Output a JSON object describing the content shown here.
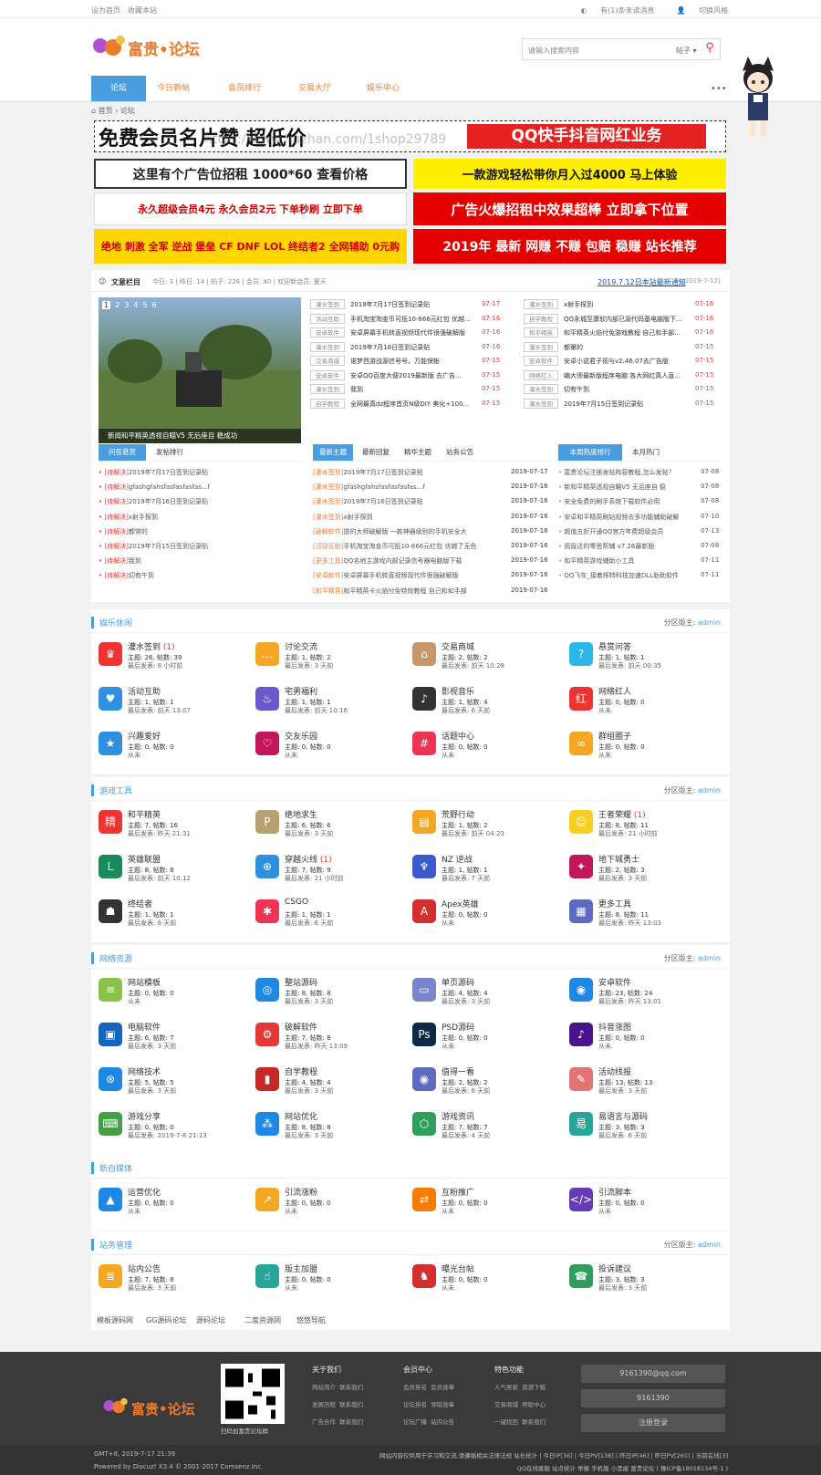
{
  "topbar": {
    "set_home": "设为首页",
    "bookmark": "收藏本站",
    "switch_style": "有(1)条未读消息",
    "login": "切换风格"
  },
  "header": {
    "logo": "富贵•论坛",
    "search_placeholder": "请输入搜索内容",
    "search_type": "帖子 ▾"
  },
  "nav": [
    "论坛",
    "今日新帖",
    "会员排行",
    "交易大厅",
    "娱乐中心"
  ],
  "breadcrumb": "首页 › 论坛",
  "ads": {
    "a1": "免费会员名片赞  超低价",
    "a1b": "QQ快手抖音网红业务",
    "a1w": "https://www.huzhan.com/1shop29789",
    "a2": "这里有个广告位招租 1000*60 查看价格",
    "a3": "一款游戏轻松带你月入过4000  马上体验",
    "a4": "永久超级会员4元 永久会员2元 下单秒刷 立即下单",
    "a5": "广告火爆招租中效果超棒 立即拿下位置",
    "a6": "绝地 刺激 全军 逆战 堡垒 CF DNF LOL 终结者2 全网辅助 0元购",
    "a7": "2019年 最新 网赚 不赚 包赔 稳赚 站长推荐"
  },
  "stats": {
    "label": "文意栏目",
    "text": "今日: 3 | 昨日: 14 | 帖子: 228 | 会员: 40 | 欢迎新会员: 夏天",
    "notice": "2019.7.12日本站最新通知",
    "notice_date": "(2019-7-12)"
  },
  "slide": {
    "pages": [
      "1",
      "2",
      "3",
      "4",
      "5",
      "6"
    ],
    "caption": "新闻和平精英透视自瞄V5 无后座自 稳成功"
  },
  "hot_left": [
    {
      "tag": "灌水签到",
      "title": "2019年7月17日签到记录贴",
      "date": "07-17"
    },
    {
      "tag": "活动互助",
      "title": "手机淘宝淘金币可抵10-666元红包 优越...",
      "date": "07-16"
    },
    {
      "tag": "安卓软件",
      "title": "安卓屏幕手机转直视频现代件很强破解版",
      "date": "07-16"
    },
    {
      "tag": "灌水签到",
      "title": "2019年7月16日签到记录贴",
      "date": "07-16"
    },
    {
      "tag": "交易商城",
      "title": "诺梦西游战源信号号，万能保帐",
      "date": "07-15"
    },
    {
      "tag": "安卓软件",
      "title": "安卓QQ百度大便2019最新版 去广告...",
      "date": "07-15"
    },
    {
      "tag": "灌水签到",
      "title": "我到",
      "date": "07-15"
    },
    {
      "tag": "自学教程",
      "title": "全网最真dz程序首页N级DIY 美化+100...",
      "date": "07-15"
    }
  ],
  "hot_right": [
    {
      "tag": "灌水签到",
      "title": "x射手探到",
      "date": "07-16"
    },
    {
      "tag": "自学教程",
      "title": "QQ永城至康软内部已源代码基电脑版下...",
      "date": "07-16"
    },
    {
      "tag": "和平精英",
      "title": "和平精英火焰付免游戏教程 自己和手部...",
      "date": "07-16"
    },
    {
      "tag": "灌水签到",
      "title": "都第的",
      "date": "07-15"
    },
    {
      "tag": "安卓软件",
      "title": "安卓小说君子视与v2.46.07去广告版",
      "date": "07-15"
    },
    {
      "tag": "网络红人",
      "title": "编大师最新版程序电脑 各大网红真人直...",
      "date": "07-15"
    },
    {
      "tag": "灌水签到",
      "title": "切有午到",
      "date": "07-15"
    },
    {
      "tag": "灌水签到",
      "title": "2019年7月15日签到记录贴",
      "date": "07-15"
    }
  ],
  "ask": {
    "tabs": [
      "问答悬赏",
      "发帖排行"
    ],
    "items": [
      {
        "s": "[待解决]",
        "t": "2019年7月17日签到记录贴"
      },
      {
        "s": "[待解决]",
        "t": "gfashgfahsfasfasfasfas...f"
      },
      {
        "s": "[待解决]",
        "t": "2019年7月16日签到记录贴"
      },
      {
        "s": "[待解决]",
        "t": "x射手探到"
      },
      {
        "s": "[待解决]",
        "t": "都常的"
      },
      {
        "s": "[待解决]",
        "t": "2019年7月15日签到记录贴"
      },
      {
        "s": "[待解决]",
        "t": "我到"
      },
      {
        "s": "[待解决]",
        "t": "切有午到"
      }
    ]
  },
  "latest": {
    "tabs": [
      "最新主题",
      "最新回复",
      "精华主题",
      "站务公告"
    ],
    "items": [
      {
        "tag": "[灌水签到]",
        "t": "2019年7月17日签到记录贴",
        "d": "2019-07-17"
      },
      {
        "tag": "[灌水签到]",
        "t": "gfashgfahsfasfasfasfas...f",
        "d": "2019-07-16"
      },
      {
        "tag": "[灌水签到]",
        "t": "2019年7月16日签到记录贴",
        "d": "2019-07-16"
      },
      {
        "tag": "[灌水签到]",
        "t": "x射手探到",
        "d": "2019-07-16"
      },
      {
        "tag": "[破解软件]",
        "t": "提的大师破解版 一款神器级别的手机安全大",
        "d": "2019-07-16"
      },
      {
        "tag": "[活动互助]",
        "t": "手机淘宝淘金币可抵10-666元红包 优越了无色",
        "d": "2019-07-16"
      },
      {
        "tag": "[更多工具]",
        "t": "QQ名地主游戏内部记录信号器电脑版下载",
        "d": "2019-07-16"
      },
      {
        "tag": "[安卓软件]",
        "t": "安卓屏幕手机转直视频现代件很强破解版",
        "d": "2019-07-16"
      },
      {
        "tag": "[和平精英]",
        "t": "和平精英卡火焰付免特效教程 自己和如手部",
        "d": "2019-07-16"
      }
    ]
  },
  "week": {
    "tabs": [
      "本周热度排行",
      "本月热门"
    ],
    "items": [
      {
        "t": "富贵论坛注册发帖阵容教程,怎么发帖？",
        "d": "07-08"
      },
      {
        "t": "新和平精英透视自瞄V5 无后座自 稳",
        "d": "07-08"
      },
      {
        "t": "安全免费的刷手系统下载软件必用",
        "d": "07-08"
      },
      {
        "t": "安卓和平精英刷钻视频去多功能辅助破解",
        "d": "07-10"
      },
      {
        "t": "超值五折开通QQ官方年费超级会员",
        "d": "07-13"
      },
      {
        "t": "雨竟达的零思帮辅 v7.26最新版",
        "d": "07-08"
      },
      {
        "t": "和平精英游戏辅助小工具",
        "d": "07-11"
      },
      {
        "t": "QQ飞车_接着辉特科技加速DLL助助软件",
        "d": "07-11"
      }
    ]
  },
  "sections": [
    {
      "title": "娱乐休闲",
      "mod": "分区版主:",
      "admin": "admin",
      "forums": [
        {
          "n": "灌水签到",
          "badge": "(1)",
          "s": "主题: 26, 帖数: 39",
          "d": "最后发表: 8 小时前",
          "c": "#e33",
          "i": "♛"
        },
        {
          "n": "讨论交流",
          "badge": "",
          "s": "主题: 1, 帖数: 2",
          "d": "最后发表: 3 天前",
          "c": "#f5a623",
          "i": "…"
        },
        {
          "n": "交易商城",
          "badge": "",
          "s": "主题: 2, 帖数: 2",
          "d": "最后发表: 前天 10:28",
          "c": "#c8966a",
          "i": "⌂"
        },
        {
          "n": "悬赏问答",
          "badge": "",
          "s": "主题: 1, 帖数: 1",
          "d": "最后发表: 前天 00:35",
          "c": "#29b6e8",
          "i": "?"
        },
        {
          "n": "活动互助",
          "badge": "",
          "s": "主题: 1, 帖数: 1",
          "d": "最后发表: 前天 13:07",
          "c": "#2f8fe0",
          "i": "♥"
        },
        {
          "n": "宅男福利",
          "badge": "",
          "s": "主题: 1, 帖数: 1",
          "d": "最后发表: 前天 10:16",
          "c": "#6a5acd",
          "i": "♨"
        },
        {
          "n": "影视音乐",
          "badge": "",
          "s": "主题: 1, 帖数: 4",
          "d": "最后发表: 6 天前",
          "c": "#333",
          "i": "♪"
        },
        {
          "n": "网络红人",
          "badge": "",
          "s": "主题: 0, 帖数: 0",
          "d": "从未",
          "c": "#e33",
          "i": "红"
        },
        {
          "n": "兴趣爱好",
          "badge": "",
          "s": "主题: 0, 帖数: 0",
          "d": "从未",
          "c": "#2f8fe0",
          "i": "★"
        },
        {
          "n": "交友乐园",
          "badge": "",
          "s": "主题: 0, 帖数: 0",
          "d": "从未",
          "c": "#c2185b",
          "i": "♡"
        },
        {
          "n": "话题中心",
          "badge": "",
          "s": "主题: 0, 帖数: 0",
          "d": "从未",
          "c": "#e35",
          "i": "#"
        },
        {
          "n": "群组圈子",
          "badge": "",
          "s": "主题: 0, 帖数: 0",
          "d": "从未",
          "c": "#f5a623",
          "i": "∞"
        }
      ]
    },
    {
      "title": "游戏工具",
      "mod": "分区版主:",
      "admin": "admin",
      "forums": [
        {
          "n": "和平精英",
          "badge": "",
          "s": "主题: 7, 帖数: 16",
          "d": "最后发表: 昨天 21:31",
          "c": "#e33",
          "i": "精"
        },
        {
          "n": "绝地求生",
          "badge": "",
          "s": "主题: 6, 帖数: 6",
          "d": "最后发表: 3 天前",
          "c": "#b8a070",
          "i": "P"
        },
        {
          "n": "荒野行动",
          "badge": "",
          "s": "主题: 1, 帖数: 2",
          "d": "最后发表: 前天 04:23",
          "c": "#f5a623",
          "i": "▤"
        },
        {
          "n": "王者荣耀",
          "badge": "(1)",
          "s": "主题: 8, 帖数: 11",
          "d": "最后发表: 21 小时前",
          "c": "#f5d020",
          "i": "☺"
        },
        {
          "n": "英雄联盟",
          "badge": "",
          "s": "主题: 8, 帖数: 8",
          "d": "最后发表: 前天 10:12",
          "c": "#1a8a5a",
          "i": "L"
        },
        {
          "n": "穿越火线",
          "badge": "(1)",
          "s": "主题: 7, 帖数: 9",
          "d": "最后发表: 21 小时前",
          "c": "#2f8fe0",
          "i": "⊕"
        },
        {
          "n": "NZ 逆战",
          "badge": "",
          "s": "主题: 1, 帖数: 1",
          "d": "最后发表: 7 天前",
          "c": "#3a5acd",
          "i": "♆"
        },
        {
          "n": "地下城勇士",
          "badge": "",
          "s": "主题: 2, 帖数: 3",
          "d": "最后发表: 3 天前",
          "c": "#c2185b",
          "i": "✦"
        },
        {
          "n": "终结者",
          "badge": "",
          "s": "主题: 1, 帖数: 1",
          "d": "最后发表: 6 天前",
          "c": "#333",
          "i": "☗"
        },
        {
          "n": "CSGO",
          "badge": "",
          "s": "主题: 1, 帖数: 1",
          "d": "最后发表: 6 天前",
          "c": "#e35",
          "i": "✱"
        },
        {
          "n": "Apex英雄",
          "badge": "",
          "s": "主题: 0, 帖数: 0",
          "d": "从未",
          "c": "#d32f2f",
          "i": "A"
        },
        {
          "n": "更多工具",
          "badge": "",
          "s": "主题: 8, 帖数: 11",
          "d": "最后发表: 昨天 13:03",
          "c": "#5c6bc0",
          "i": "▦"
        }
      ]
    },
    {
      "title": "网络资源",
      "mod": "分区版主:",
      "admin": "admin",
      "forums": [
        {
          "n": "网站模板",
          "badge": "",
          "s": "主题: 0, 帖数: 0",
          "d": "从未",
          "c": "#8bc34a",
          "i": "≡"
        },
        {
          "n": "整站源码",
          "badge": "",
          "s": "主题: 8, 帖数: 8",
          "d": "最后发表: 3 天前",
          "c": "#1e88e5",
          "i": "◎"
        },
        {
          "n": "单页源码",
          "badge": "",
          "s": "主题: 4, 帖数: 4",
          "d": "最后发表: 3 天前",
          "c": "#7986cb",
          "i": "▭"
        },
        {
          "n": "安卓软件",
          "badge": "",
          "s": "主题: 23, 帖数: 24",
          "d": "最后发表: 昨天 13:01",
          "c": "#1e88e5",
          "i": "◉"
        },
        {
          "n": "电脑软件",
          "badge": "",
          "s": "主题: 6, 帖数: 7",
          "d": "最后发表: 3 天前",
          "c": "#1565c0",
          "i": "▣"
        },
        {
          "n": "破解软件",
          "badge": "",
          "s": "主题: 7, 帖数: 8",
          "d": "最后发表: 昨天 13:09",
          "c": "#e53935",
          "i": "⚙"
        },
        {
          "n": "PSD源码",
          "badge": "",
          "s": "主题: 0, 帖数: 0",
          "d": "从未",
          "c": "#0b2a4a",
          "i": "Ps"
        },
        {
          "n": "抖音涨图",
          "badge": "",
          "s": "主题: 0, 帖数: 0",
          "d": "从未",
          "c": "#4a148c",
          "i": "♪"
        },
        {
          "n": "网络技术",
          "badge": "",
          "s": "主题: 5, 帖数: 5",
          "d": "最后发表: 3 天前",
          "c": "#1e88e5",
          "i": "⊛"
        },
        {
          "n": "自学教程",
          "badge": "",
          "s": "主题: 4, 帖数: 4",
          "d": "最后发表: 3 天前",
          "c": "#c62828",
          "i": "▮"
        },
        {
          "n": "值得一看",
          "badge": "",
          "s": "主题: 2, 帖数: 2",
          "d": "最后发表: 6 天前",
          "c": "#5c6bc0",
          "i": "◉"
        },
        {
          "n": "活动线报",
          "badge": "",
          "s": "主题: 13, 帖数: 13",
          "d": "最后发表: 3 天前",
          "c": "#e57373",
          "i": "✎"
        },
        {
          "n": "游戏分享",
          "badge": "",
          "s": "主题: 0, 帖数: 0",
          "d": "最后发表: 2019-7-8 21:13",
          "c": "#43a047",
          "i": "⌨"
        },
        {
          "n": "网站优化",
          "badge": "",
          "s": "主题: 8, 帖数: 8",
          "d": "最后发表: 3 天前",
          "c": "#1e88e5",
          "i": "⁂"
        },
        {
          "n": "游戏资讯",
          "badge": "",
          "s": "主题: 7, 帖数: 7",
          "d": "最后发表: 4 天前",
          "c": "#2e9e5a",
          "i": "⬡"
        },
        {
          "n": "易语言与源码",
          "badge": "",
          "s": "主题: 3, 帖数: 3",
          "d": "最后发表: 6 天前",
          "c": "#26a69a",
          "i": "易"
        }
      ]
    },
    {
      "title": "新自媒体",
      "mod": "",
      "admin": "",
      "forums": [
        {
          "n": "运营优化",
          "badge": "",
          "s": "主题: 0, 帖数: 0",
          "d": "从未",
          "c": "#1e88e5",
          "i": "▲"
        },
        {
          "n": "引流涨粉",
          "badge": "",
          "s": "主题: 0, 帖数: 0",
          "d": "从未",
          "c": "#f5a623",
          "i": "↗"
        },
        {
          "n": "互粉推广",
          "badge": "",
          "s": "主题: 0, 帖数: 0",
          "d": "从未",
          "c": "#f57c00",
          "i": "⇄"
        },
        {
          "n": "引流脚本",
          "badge": "",
          "s": "主题: 0, 帖数: 0",
          "d": "从未",
          "c": "#673ab7",
          "i": "</>"
        }
      ]
    },
    {
      "title": "站务管理",
      "mod": "分区版主:",
      "admin": "admin",
      "forums": [
        {
          "n": "站内公告",
          "badge": "",
          "s": "主题: 7, 帖数: 8",
          "d": "最后发表: 3 天前",
          "c": "#f5a623",
          "i": "≣"
        },
        {
          "n": "版主加盟",
          "badge": "",
          "s": "主题: 0, 帖数: 0",
          "d": "从未",
          "c": "#26a69a",
          "i": "☝"
        },
        {
          "n": "曝光台帖",
          "badge": "",
          "s": "主题: 0, 帖数: 0",
          "d": "从未",
          "c": "#d32f2f",
          "i": "♞"
        },
        {
          "n": "投诉建议",
          "badge": "",
          "s": "主题: 3, 帖数: 3",
          "d": "最后发表: 3 天前",
          "c": "#2e9e5a",
          "i": "☎"
        }
      ]
    }
  ],
  "links": [
    "模板源码网",
    "GG源码论坛",
    "源码论坛",
    "二度资源网",
    "悠悠导航"
  ],
  "footer": {
    "logo": "富贵•论坛",
    "qr_caption": "扫码加富贵论坛群",
    "cols": [
      {
        "h": "关于我们",
        "items": [
          "网站简介",
          "联系我们",
          "发展历程",
          "联系我们",
          "广告合作",
          "联系我们"
        ]
      },
      {
        "h": "会员中心",
        "items": [
          "会员排名",
          "会员勋章",
          "论坛排名",
          "领取勋章",
          "论坛广播",
          "站内公告"
        ]
      },
      {
        "h": "特色功能",
        "items": [
          "人气居家",
          "资源下载",
          "交易商城",
          "帮助中心",
          "一键找回",
          "联系我们"
        ]
      }
    ],
    "email": "9161390@qq.com",
    "qq": "9161390",
    "login": "注册登录",
    "left1": "GMT+8, 2019-7-17 21:39",
    "left2": "Powered by Discuz! X3.4 © 2001-2017 Comsenz Inc.",
    "right1": "网站内容仅供用于学习和交流,请遵循相关法律法规 站长统计 | 今日IP[36] | 今日PV[138] | 昨日IP[46] | 昨日PV[265] | 当前在线[3]",
    "right2": "QQ在线客服 站点统计 举报 手机版 小黑屋 富贵论坛 ( 豫ICP备18018134号-1 )"
  }
}
